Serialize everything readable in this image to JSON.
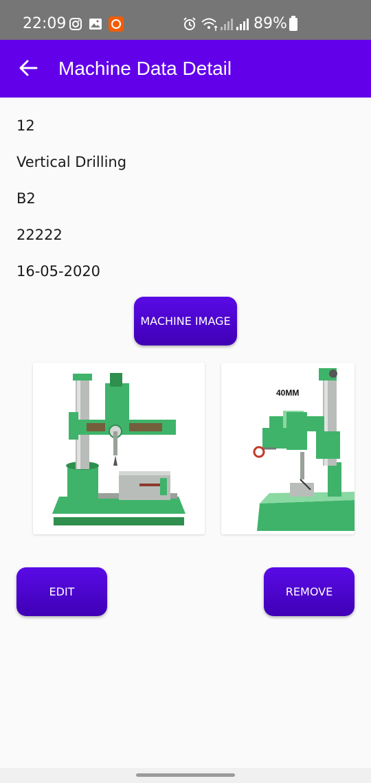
{
  "status_bar": {
    "time": "22:09",
    "battery": "89%"
  },
  "app_bar": {
    "title": "Machine Data Detail"
  },
  "details": {
    "id": "12",
    "name": "Vertical Drilling",
    "location": "B2",
    "number": "22222",
    "date": "16-05-2020"
  },
  "buttons": {
    "machine_image": "MACHINE IMAGE",
    "edit": "EDIT",
    "remove": "REMOVE"
  },
  "images": {
    "second_label": "40MM"
  },
  "colors": {
    "app_bar": "#6200ea",
    "button": "#4a05cc",
    "status_bar": "#767676",
    "machine_green": "#3fb36a"
  }
}
